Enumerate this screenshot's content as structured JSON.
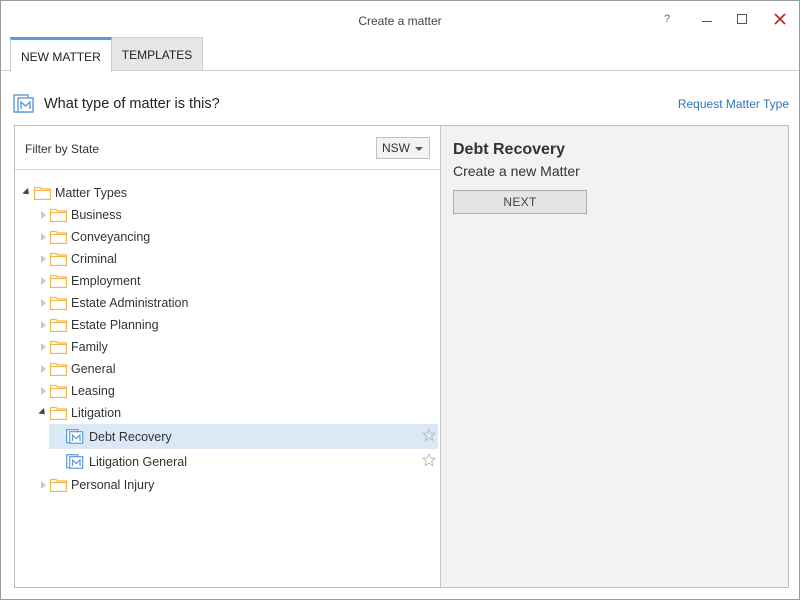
{
  "window": {
    "title": "Create a matter",
    "help_label": "?"
  },
  "tabs": [
    {
      "label": "NEW MATTER",
      "active": true
    },
    {
      "label": "TEMPLATES",
      "active": false
    }
  ],
  "header": {
    "icon": "matter-icon",
    "question": "What type of matter is this?",
    "request_link": "Request Matter Type"
  },
  "filter": {
    "label": "Filter by State",
    "selected_state": "NSW"
  },
  "tree": {
    "root": {
      "label": "Matter Types",
      "expanded": true
    },
    "items": [
      {
        "label": "Business"
      },
      {
        "label": "Conveyancing"
      },
      {
        "label": "Criminal"
      },
      {
        "label": "Employment"
      },
      {
        "label": "Estate Administration"
      },
      {
        "label": "Estate Planning"
      },
      {
        "label": "Family"
      },
      {
        "label": "General"
      },
      {
        "label": "Leasing"
      },
      {
        "label": "Litigation",
        "expanded": true
      },
      {
        "label": "Personal Injury"
      }
    ],
    "litigation_children": [
      {
        "label": "Debt Recovery",
        "selected": true
      },
      {
        "label": "Litigation General",
        "selected": false
      }
    ]
  },
  "detail": {
    "title": "Debt Recovery",
    "subtitle": "Create a new Matter",
    "next_label": "NEXT"
  },
  "colors": {
    "accent": "#5b9bd5",
    "link": "#2e75b6",
    "folder": "#f0b94a",
    "selected_row": "#dbe9f6",
    "close": "#c42b1c"
  }
}
